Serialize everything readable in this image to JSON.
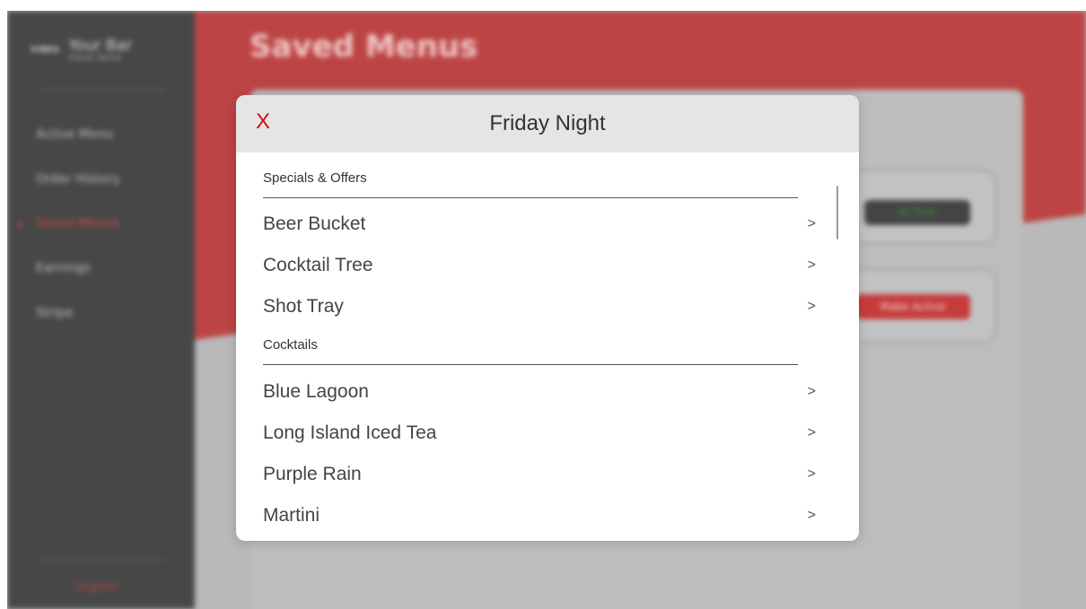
{
  "sidebar": {
    "brand_logo": "VIBES",
    "brand_name": "Your Bar",
    "brand_sub": "Owner Name",
    "items": [
      {
        "label": "Active Menu"
      },
      {
        "label": "Order History"
      },
      {
        "label": "Saved Menus"
      },
      {
        "label": "Earnings"
      },
      {
        "label": "Stripe"
      }
    ],
    "logout_label": "Logout"
  },
  "main": {
    "title": "Saved Menus",
    "active_badge": "ACTIVE",
    "make_active_label": "Make Active"
  },
  "modal": {
    "close_label": "X",
    "title": "Friday Night",
    "sections": [
      {
        "title": "Specials & Offers",
        "items": [
          {
            "name": "Beer Bucket",
            "chevron": ">"
          },
          {
            "name": "Cocktail Tree",
            "chevron": ">"
          },
          {
            "name": "Shot Tray",
            "chevron": ">"
          }
        ]
      },
      {
        "title": "Cocktails",
        "items": [
          {
            "name": "Blue Lagoon",
            "chevron": ">"
          },
          {
            "name": "Long Island Iced Tea",
            "chevron": ">"
          },
          {
            "name": "Purple Rain",
            "chevron": ">"
          },
          {
            "name": "Martini",
            "chevron": ">"
          }
        ]
      }
    ]
  },
  "colors": {
    "accent_red": "#bd4444",
    "close_red": "#d01010",
    "sidebar_bg": "#474747"
  }
}
